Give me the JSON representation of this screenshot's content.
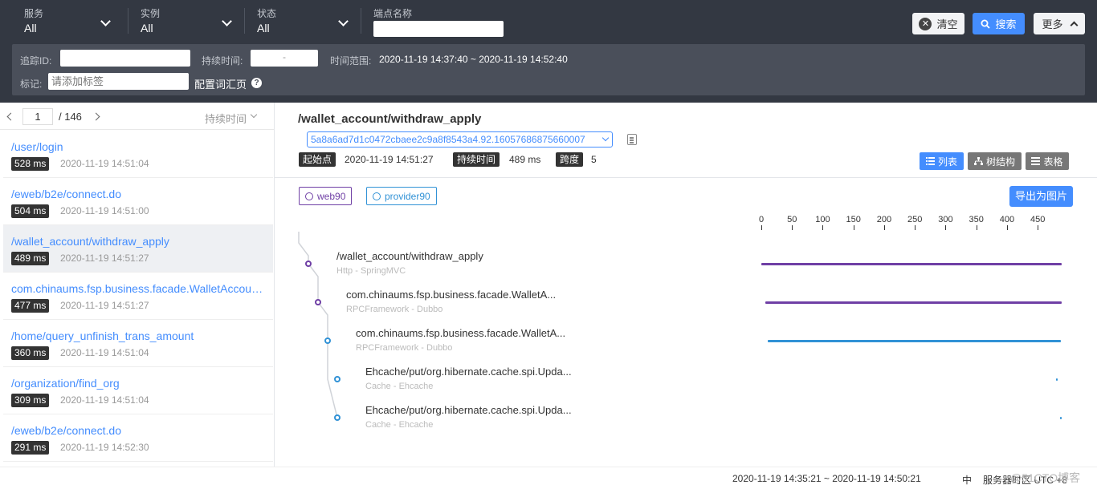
{
  "filters": [
    {
      "label": "服务",
      "value": "All"
    },
    {
      "label": "实例",
      "value": "All"
    },
    {
      "label": "状态",
      "value": "All"
    }
  ],
  "endpoint": {
    "label": "端点名称",
    "value": ""
  },
  "buttons": {
    "clear": "清空",
    "search": "搜索",
    "more": "更多"
  },
  "advanced": {
    "trace_id_label": "追踪ID:",
    "duration_label": "持续时间:",
    "duration_sep": "-",
    "time_range_label": "时间范围:",
    "time_range_value": "2020-11-19 14:37:40 ~ 2020-11-19 14:52:40",
    "tags_label": "标记:",
    "tags_placeholder": "请添加标签",
    "config_vocab": "配置词汇页"
  },
  "pager": {
    "page": "1",
    "total": "/ 146",
    "sort": "持续时间"
  },
  "traces": [
    {
      "endpoint": "/user/login",
      "duration": "528 ms",
      "time": "2020-11-19 14:51:04"
    },
    {
      "endpoint": "/eweb/b2e/connect.do",
      "duration": "504 ms",
      "time": "2020-11-19 14:51:00"
    },
    {
      "endpoint": "/wallet_account/withdraw_apply",
      "duration": "489 ms",
      "time": "2020-11-19 14:51:27"
    },
    {
      "endpoint": "com.chinaums.fsp.business.facade.WalletAccoun...",
      "duration": "477 ms",
      "time": "2020-11-19 14:51:27"
    },
    {
      "endpoint": "/home/query_unfinish_trans_amount",
      "duration": "360 ms",
      "time": "2020-11-19 14:51:04"
    },
    {
      "endpoint": "/organization/find_org",
      "duration": "309 ms",
      "time": "2020-11-19 14:51:04"
    },
    {
      "endpoint": "/eweb/b2e/connect.do",
      "duration": "291 ms",
      "time": "2020-11-19 14:52:30"
    }
  ],
  "detail": {
    "title": "/wallet_account/withdraw_apply",
    "trace_id": "5a8a6ad7d1c0472cbaee2c9a8f8543a4.92.16057686875660007",
    "start_label": "起始点",
    "start_value": "2020-11-19 14:51:27",
    "duration_label": "持续时间",
    "duration_value": "489 ms",
    "spans_label": "跨度",
    "spans_value": "5",
    "views": {
      "list": "列表",
      "tree": "树结构",
      "table": "表格"
    },
    "export": "导出为图片",
    "legend": [
      {
        "name": "web90",
        "color": "#6f3fa5"
      },
      {
        "name": "provider90",
        "color": "#3192d6"
      }
    ]
  },
  "timeline": {
    "axis": [
      "0",
      "50",
      "100",
      "150",
      "200",
      "250",
      "300",
      "350",
      "400",
      "450"
    ],
    "axis_max_ms": 489,
    "spans": [
      {
        "name": "/wallet_account/withdraw_apply",
        "component": "Http - SpringMVC",
        "level": 0,
        "start": 0,
        "end": 489,
        "color": "#6f3fa5"
      },
      {
        "name": "com.chinaums.fsp.business.facade.WalletA...",
        "component": "RPCFramework - Dubbo",
        "level": 1,
        "start": 7,
        "end": 489,
        "color": "#6f3fa5"
      },
      {
        "name": "com.chinaums.fsp.business.facade.WalletA...",
        "component": "RPCFramework - Dubbo",
        "level": 2,
        "start": 10,
        "end": 488,
        "color": "#3192d6"
      },
      {
        "name": "Ehcache/put/org.hibernate.cache.spi.Upda...",
        "component": "Cache - Ehcache",
        "level": 3,
        "start": 480,
        "end": 481,
        "color": "#3192d6"
      },
      {
        "name": "Ehcache/put/org.hibernate.cache.spi.Upda...",
        "component": "Cache - Ehcache",
        "level": 3,
        "start": 487,
        "end": 488,
        "color": "#3192d6"
      }
    ]
  },
  "footer": {
    "range": "2020-11-19 14:35:21 ~ 2020-11-19 14:50:21",
    "lang": "中",
    "server": "服务器时区 UTC +8",
    "watermark": "@51CTO博客"
  }
}
